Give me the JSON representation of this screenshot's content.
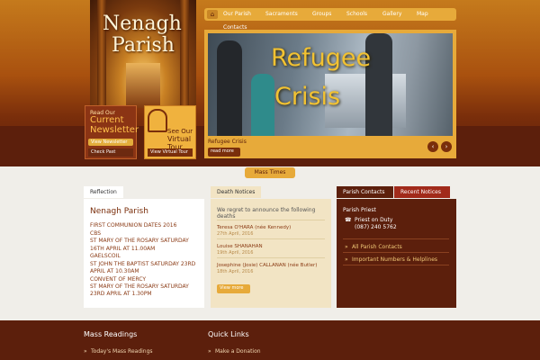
{
  "header": {
    "logo_line1": "Nenagh",
    "logo_line2": "Parish"
  },
  "newsletter": {
    "small": "Read Our",
    "big1": "Current",
    "big2": "Newsletter",
    "view_btn": "View Newsletter",
    "past_btn": "Check Past"
  },
  "tour": {
    "line1": "See Our",
    "line2": "Virtual Tour",
    "btn": "View Virtual Tour"
  },
  "nav": {
    "items": [
      "Our Parish",
      "Sacraments",
      "Groups",
      "Schools",
      "Gallery",
      "Map"
    ],
    "second_row": "Contacts"
  },
  "slider": {
    "headline1": "Refugee",
    "headline2": "Crisis",
    "caption": "Refugee Crisis",
    "read_more": "read more",
    "prev": "‹",
    "next": "›"
  },
  "mass_times": "Mass Times",
  "reflection": {
    "tab": "Reflection",
    "title": "Nenagh Parish",
    "lines": [
      "FIRST COMMUNION DATES 2016",
      "CBS",
      "ST MARY OF THE ROSARY SATURDAY",
      "16TH APRIL AT 11.00AM",
      "GAELSCOIL",
      "ST JOHN THE BAPTIST SATURDAY 23RD",
      "APRIL AT 10.30AM",
      "CONVENT OF MERCY",
      "ST MARY OF THE ROSARY SATURDAY",
      "23RD APRIL AT 1.30PM"
    ]
  },
  "death": {
    "tab": "Death Notices",
    "intro1": "We regret to announce the following",
    "intro2": "deaths",
    "entries": [
      {
        "name": "Teresa O'HARA (née Kennedy)",
        "date": "27th April, 2016"
      },
      {
        "name": "Louise SHANAHAN",
        "date": "19th April, 2016"
      },
      {
        "name": "Josephine (Josie) CALLANAN (née Butler)",
        "date": "18th April, 2016"
      }
    ],
    "view_btn": "View more"
  },
  "contacts": {
    "tab1": "Parish Contacts",
    "tab2": "Recent Notices",
    "priest_label": "Parish Priest",
    "duty1": "Priest on Duty",
    "duty2": "(087) 240 5762",
    "links": [
      "All Parish Contacts",
      "Important Numbers & Helplines"
    ]
  },
  "footer": {
    "col1_title": "Mass Readings",
    "col1_link": "Today's Mass Readings",
    "col2_title": "Quick Links",
    "col2_link": "Make a Donation"
  },
  "colors": {
    "brand_dark": "#5c1f0c",
    "accent_gold": "#e7aa3a",
    "link_brown": "#8a3a14"
  }
}
